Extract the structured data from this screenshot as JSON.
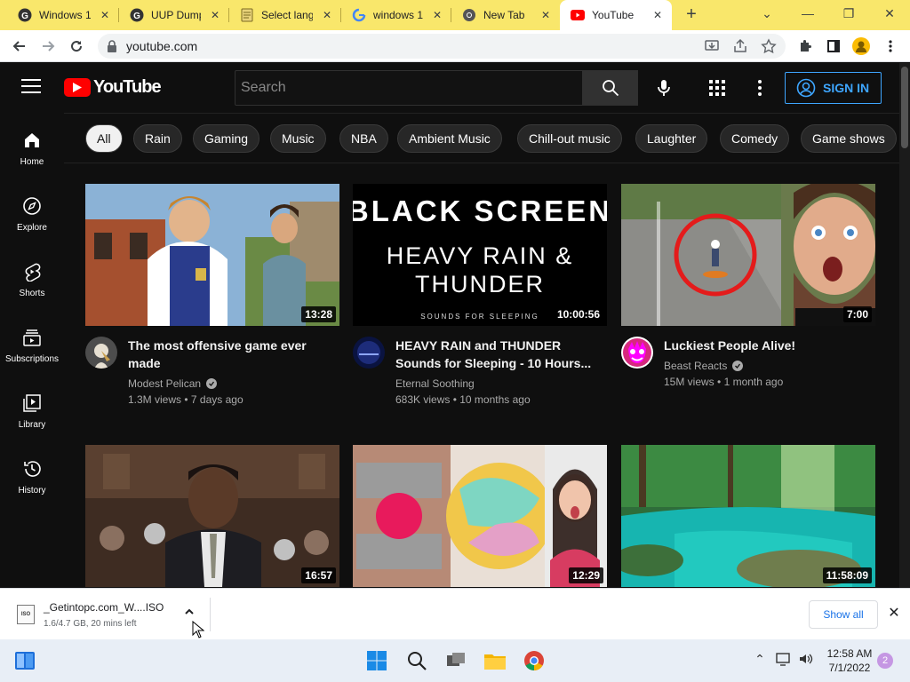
{
  "browser": {
    "tabs": [
      {
        "title": "Windows 1",
        "favicon": "gamer-avatar-icon"
      },
      {
        "title": "UUP Dump",
        "favicon": "gamer-avatar-icon"
      },
      {
        "title": "Select lang",
        "favicon": "page-icon"
      },
      {
        "title": "windows 1",
        "favicon": "google-icon"
      },
      {
        "title": "New Tab",
        "favicon": "chrome-icon"
      },
      {
        "title": "YouTube",
        "favicon": "youtube-icon",
        "active": true
      }
    ],
    "url": "youtube.com",
    "frame_color": "#f9e76b"
  },
  "youtube": {
    "search_placeholder": "Search",
    "sign_in_label": "SIGN IN",
    "logo_text": "YouTube",
    "chips": [
      "All",
      "Rain",
      "Gaming",
      "Music",
      "NBA",
      "Ambient Music",
      "Chill-out music",
      "Laughter",
      "Comedy",
      "Game shows"
    ],
    "sidebar": [
      {
        "label": "Home",
        "icon": "home-icon"
      },
      {
        "label": "Explore",
        "icon": "compass-icon"
      },
      {
        "label": "Shorts",
        "icon": "shorts-icon"
      },
      {
        "label": "Subscriptions",
        "icon": "subscriptions-icon"
      },
      {
        "label": "Library",
        "icon": "library-icon"
      },
      {
        "label": "History",
        "icon": "history-icon"
      }
    ],
    "videos": [
      {
        "title": "The most offensive game ever made",
        "channel": "Modest Pelican",
        "verified": true,
        "views": "1.3M views",
        "age": "7 days ago",
        "duration": "13:28"
      },
      {
        "title": "HEAVY RAIN and THUNDER Sounds for Sleeping - 10 Hours...",
        "channel": "Eternal Soothing",
        "verified": false,
        "views": "683K views",
        "age": "10 months ago",
        "duration": "10:00:56",
        "thumb_line1": "BLACK SCREEN",
        "thumb_line2": "HEAVY RAIN &",
        "thumb_line3": "THUNDER",
        "thumb_line4": "SOUNDS FOR SLEEPING"
      },
      {
        "title": "Luckiest People Alive!",
        "channel": "Beast Reacts",
        "verified": true,
        "views": "15M views",
        "age": "1 month ago",
        "duration": "7:00"
      },
      {
        "title": "",
        "channel": "",
        "views": "",
        "age": "",
        "duration": "16:57"
      },
      {
        "title": "",
        "channel": "",
        "views": "",
        "age": "",
        "duration": "12:29"
      },
      {
        "title": "",
        "channel": "",
        "views": "",
        "age": "",
        "duration": "11:58:09"
      }
    ]
  },
  "download": {
    "filename": "_Getintopc.com_W....ISO",
    "progress": "1.6/4.7 GB, 20 mins left",
    "file_icon_text": "ISO",
    "show_all_label": "Show all"
  },
  "taskbar": {
    "time": "12:58 AM",
    "date": "7/1/2022",
    "notification_count": "2"
  }
}
